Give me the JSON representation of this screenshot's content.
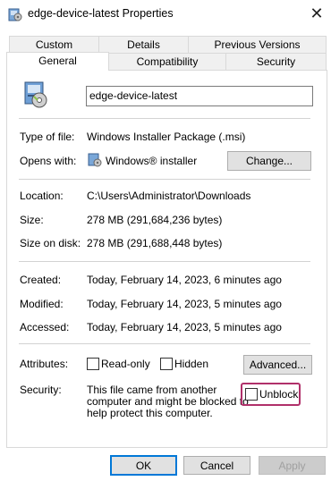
{
  "window": {
    "title": "edge-device-latest Properties",
    "close_glyph": "✕"
  },
  "tabs": {
    "row1": [
      "Custom",
      "Details",
      "Previous Versions"
    ],
    "row2": [
      "General",
      "Compatibility",
      "Security"
    ],
    "active": "General"
  },
  "general": {
    "file_name": "edge-device-latest",
    "type_label": "Type of file:",
    "type_value": "Windows Installer Package (.msi)",
    "opens_label": "Opens with:",
    "opens_value": "Windows® installer",
    "change_button": "Change...",
    "location_label": "Location:",
    "location_value": "C:\\Users\\Administrator\\Downloads",
    "size_label": "Size:",
    "size_value": "278 MB (291,684,236 bytes)",
    "size_on_disk_label": "Size on disk:",
    "size_on_disk_value": "278 MB (291,688,448 bytes)",
    "created_label": "Created:",
    "created_value": "Today, February 14, 2023, 6 minutes ago",
    "modified_label": "Modified:",
    "modified_value": "Today, February 14, 2023, 5 minutes ago",
    "accessed_label": "Accessed:",
    "accessed_value": "Today, February 14, 2023, 5 minutes ago",
    "attributes_label": "Attributes:",
    "readonly_label": "Read-only",
    "hidden_label": "Hidden",
    "advanced_button": "Advanced...",
    "security_label": "Security:",
    "security_line1": "This file came from another",
    "security_line2": "computer and might be blocked to",
    "security_line3": "help protect this computer.",
    "unblock_label": "Unblock"
  },
  "footer": {
    "ok": "OK",
    "cancel": "Cancel",
    "apply": "Apply"
  },
  "colors": {
    "accent": "#0078d7",
    "highlight": "#b0306a"
  }
}
